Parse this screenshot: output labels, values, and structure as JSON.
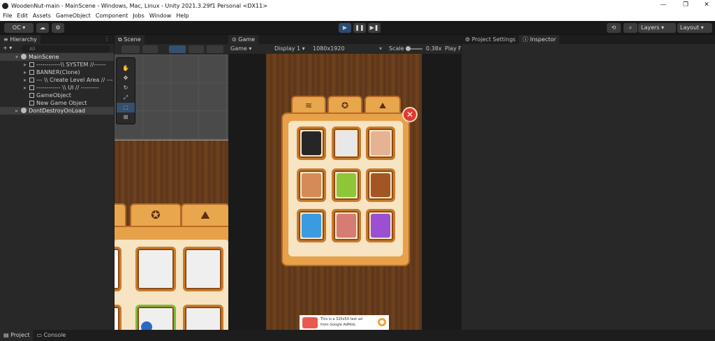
{
  "window": {
    "title": "WoodenNut-main - MainScene - Windows, Mac, Linux - Unity 2021.3.29f1 Personal <DX11>",
    "min": "—",
    "max": "❐",
    "close": "✕"
  },
  "menu": [
    "File",
    "Edit",
    "Assets",
    "GameObject",
    "Component",
    "Jobs",
    "Window",
    "Help"
  ],
  "toolbar": {
    "account": "OC ▾",
    "play": "▶",
    "pause": "❚❚",
    "step": "▶❚",
    "layers": "Layers",
    "layout": "Layout"
  },
  "hierarchy": {
    "tab": "Hierarchy",
    "search_placeholder": "All",
    "add": "+ ▾",
    "items": [
      {
        "label": "MainScene",
        "type": "scene"
      },
      {
        "label": "------------\\\\ SYSTEM //------",
        "type": "obj"
      },
      {
        "label": "BANNER(Clone)",
        "type": "obj"
      },
      {
        "label": "--- \\\\ Create Level Area // ---",
        "type": "obj"
      },
      {
        "label": "------------ \\\\ UI // ---------",
        "type": "obj"
      },
      {
        "label": "GameObject",
        "type": "obj"
      },
      {
        "label": "New Game Object",
        "type": "obj"
      },
      {
        "label": "DontDestroyOnLoad",
        "type": "scene"
      }
    ]
  },
  "scene": {
    "tab": "Scene"
  },
  "game": {
    "tab": "Game",
    "mode": "Game",
    "display": "Display 1",
    "resolution": "1080x1920",
    "scale_label": "Scale",
    "scale_value": "0.38x",
    "play_label": "Play F"
  },
  "right": {
    "project_settings": "Project Settings",
    "inspector": "Inspector"
  },
  "bottom": {
    "project": "Project",
    "console": "Console"
  },
  "ad": {
    "line1": "This is a 320x50 test ad",
    "line2": "from Google AdMob."
  },
  "colors": {
    "tiles": [
      "#262626",
      "#e8e8e8",
      "#e6b294",
      "#d58b57",
      "#8ec63a",
      "#a35524",
      "#3a9be0",
      "#d77c74",
      "#9b4fd2"
    ]
  }
}
